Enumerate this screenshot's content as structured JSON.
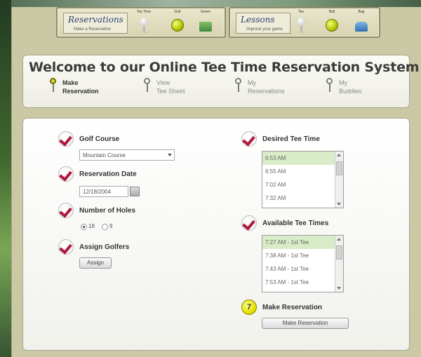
{
  "colors": {
    "frame": "#cbc8a6",
    "check": "#b0183b",
    "active_pin": "#e1dd2b",
    "selected_option": "#d8ecc8"
  },
  "top_bar": {
    "reservations_panel": {
      "logo_title": "Reservations",
      "logo_subtitle": "Make a Reservation",
      "icons": [
        {
          "caption": "Tee Time",
          "icon": "tee-icon"
        },
        {
          "caption": "Golf",
          "icon": "golf-ball-icon"
        },
        {
          "caption": "Green",
          "icon": "green-icon"
        }
      ]
    },
    "lessons_panel": {
      "logo_title": "Lessons",
      "logo_subtitle": "Improve your game",
      "icons": [
        {
          "caption": "Tee",
          "icon": "tee-icon"
        },
        {
          "caption": "Ball",
          "icon": "golf-ball-icon"
        },
        {
          "caption": "Bag",
          "icon": "golf-bag-icon"
        }
      ]
    }
  },
  "header": {
    "title": "Welcome to our Online Tee Time Reservation System",
    "nav": [
      {
        "line1": "Make",
        "line2": "Reservation",
        "active": true
      },
      {
        "line1": "View",
        "line2": "Tee Sheet",
        "active": false
      },
      {
        "line1": "My",
        "line2": "Reservations",
        "active": false
      },
      {
        "line1": "My",
        "line2": "Buddies",
        "active": false
      }
    ]
  },
  "form": {
    "golf_course": {
      "label": "Golf Course",
      "value": "Mountain Course"
    },
    "reservation_date": {
      "label": "Reservation Date",
      "value": "12/18/2004"
    },
    "number_of_holes": {
      "label": "Number of Holes",
      "options": [
        "18",
        "9"
      ],
      "selected": "18"
    },
    "assign_golfers": {
      "label": "Assign Golfers",
      "button": "Assign"
    },
    "desired_tee_time": {
      "label": "Desired Tee Time",
      "options": [
        "6:53 AM",
        "6:55 AM",
        "7:02 AM",
        "7:32 AM"
      ],
      "selected_index": 0
    },
    "available_tee_times": {
      "label": "Available Tee Times",
      "options": [
        "7:27 AM - 1st Tee",
        "7:38 AM - 1st Tee",
        "7:43 AM - 1st Tee",
        "7:53 AM - 1st Tee"
      ],
      "selected_index": 0
    },
    "make_reservation": {
      "step": "7",
      "label": "Make Reservation",
      "button": "Make Reservation"
    }
  }
}
